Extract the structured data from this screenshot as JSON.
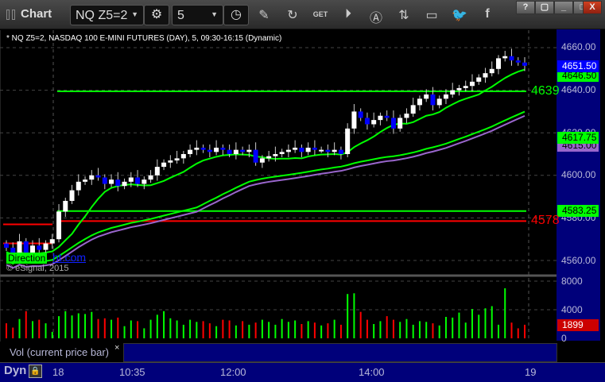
{
  "window": {
    "title": "Chart",
    "symbol": "NQ Z5=2",
    "interval": "5",
    "controls": [
      "?",
      "▢",
      "_",
      "□",
      "X"
    ]
  },
  "toolbar_icons": [
    "settings-icon",
    "clock-icon",
    "pencil-icon",
    "refresh-icon",
    "get-icon",
    "play-icon",
    "alert-icon",
    "swap-icon",
    "comment-icon",
    "twitter-icon",
    "facebook-icon"
  ],
  "chart": {
    "description": "* NQ Z5=2, NASDAQ 100 E-MINI FUTURES (DAY), 5, 09:30-16:15 (Dynamic)",
    "price_labels": [
      "4660.00",
      "4640.00",
      "4620.00",
      "4600.00",
      "4580.00",
      "4560.00"
    ],
    "price_values": [
      4660,
      4640,
      4620,
      4600,
      4580,
      4560
    ],
    "tags": {
      "last": "4651.50",
      "ma_fast": "4646.50",
      "ma_green": "4617.75",
      "ma_purple": "4615.00",
      "level_green": "4583.25"
    },
    "level_labels": {
      "upper": "4639",
      "lower": "4578"
    },
    "levels": {
      "upper": 4639.5,
      "lower": 4578.5,
      "green": 4583.25,
      "red_pre1": 4577,
      "red_pre2": 4574
    },
    "closes": [
      4566,
      4563,
      4569,
      4562,
      4567,
      4565,
      4568,
      4570,
      4583,
      4588,
      4593,
      4597,
      4598,
      4600,
      4599,
      4596,
      4598,
      4595,
      4597,
      4599,
      4596,
      4598,
      4600,
      4604,
      4606,
      4607,
      4608,
      4610,
      4612,
      4613,
      4612,
      4611,
      4613,
      4612,
      4610,
      4612,
      4611,
      4612,
      4606,
      4608,
      4609,
      4610,
      4611,
      4612,
      4613,
      4611,
      4613,
      4612,
      4612,
      4611,
      4612,
      4610,
      4622,
      4630,
      4627,
      4624,
      4626,
      4628,
      4627,
      4622,
      4627,
      4629,
      4633,
      4636,
      4638,
      4633,
      4636,
      4638,
      4640,
      4641,
      4642,
      4644,
      4646,
      4648,
      4650,
      4655,
      4656,
      4654,
      4653,
      4651.5
    ],
    "watermark": "Direction",
    "watermark_link": "ht.com",
    "copyright": "© eSignal, 2015"
  },
  "volume": {
    "labels": [
      "8000",
      "4000",
      "0"
    ],
    "last_tag": "1899",
    "values": [
      2100,
      1500,
      2700,
      3800,
      2400,
      2600,
      2100,
      900,
      3100,
      3800,
      3200,
      3500,
      3400,
      3700,
      2700,
      2800,
      2600,
      2900,
      1700,
      2500,
      2400,
      1400,
      2600,
      3300,
      3800,
      2800,
      2500,
      1900,
      2600,
      2300,
      2400,
      2100,
      1700,
      2600,
      2500,
      1800,
      2400,
      1900,
      2200,
      2600,
      2300,
      1900,
      2700,
      2300,
      2500,
      2000,
      2400,
      2200,
      1800,
      2100,
      2600,
      1900,
      6200,
      6300,
      3700,
      2600,
      2000,
      2400,
      3100,
      2600,
      2300,
      2700,
      1900,
      2400,
      2300,
      2100,
      1800,
      3000,
      2900,
      3600,
      2200,
      4100,
      3300,
      4200,
      4500,
      1900,
      7000,
      2200,
      1400,
      1899
    ],
    "max": 8000
  },
  "study": {
    "label": "Vol (current price bar)",
    "close": "×"
  },
  "timeaxis": {
    "mode": "Dyn",
    "labels": [
      "18",
      "10:35",
      "12:00",
      "14:00",
      "19"
    ]
  },
  "colors": {
    "up": "#ffffff",
    "down": "#0000ff",
    "green": "#00ff00",
    "red": "#ff0000",
    "purple": "#9966cc",
    "axis": "#00007a"
  }
}
